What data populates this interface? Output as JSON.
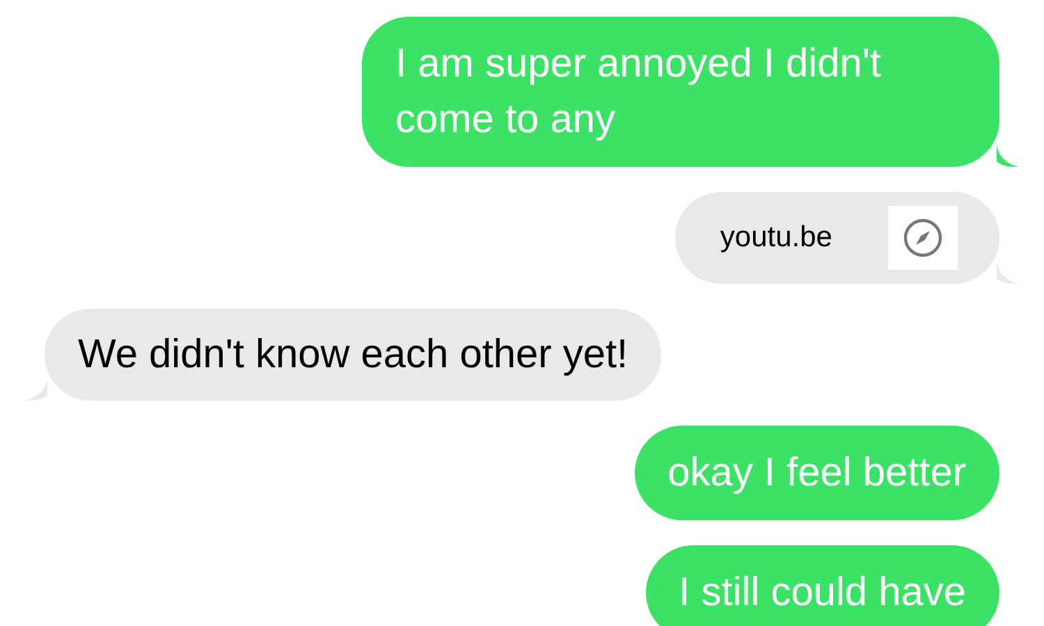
{
  "messages": [
    {
      "sent": true,
      "kind": "text",
      "text": "I am super annoyed I didn't come to any",
      "tail": true
    },
    {
      "sent": true,
      "kind": "link",
      "text": "youtu.be",
      "tail": true
    },
    {
      "sent": false,
      "kind": "text",
      "text": "We didn't know each other yet!",
      "tail": true
    },
    {
      "sent": true,
      "kind": "text",
      "text": "okay I feel better",
      "tail": false
    },
    {
      "sent": true,
      "kind": "text",
      "text": "I still could have",
      "tail": false
    }
  ]
}
